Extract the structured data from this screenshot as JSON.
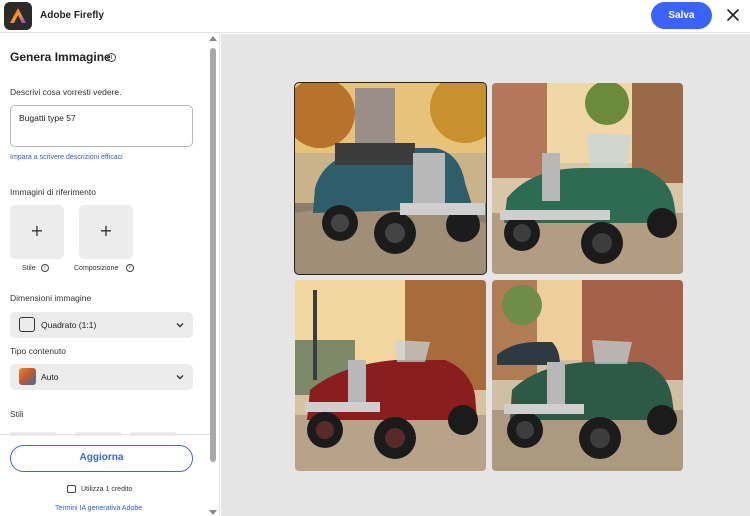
{
  "header": {
    "app_title": "Adobe Firefly",
    "save_label": "Salva",
    "logo_icon": "adobe-firefly-logo",
    "close_icon": "close-icon",
    "accent_color": "#3b63fb"
  },
  "sidebar": {
    "title": "Genera Immagine",
    "prompt_label": "Descrivi cosa vorresti vedere.",
    "prompt_value": "Bugatti type 57",
    "learn_link": "Impara a scrivere descrizioni efficaci",
    "reference_label": "Immagini di riferimento",
    "reference_items": [
      {
        "label": "Stile",
        "icon": "plus-icon"
      },
      {
        "label": "Composizione",
        "icon": "plus-icon"
      }
    ],
    "dimensions_label": "Dimensioni immagine",
    "dimensions_value": "Quadrato (1:1)",
    "content_type_label": "Tipo contenuto",
    "content_type_value": "Auto",
    "styles_label": "Stili",
    "update_label": "Aggiorna",
    "credits_text": "Utilizza 1 credito",
    "terms_link": "Termini IA generativa Adobe"
  },
  "gallery": {
    "images": [
      {
        "icon": "generated-image",
        "selected": true
      },
      {
        "icon": "generated-image",
        "selected": false
      },
      {
        "icon": "generated-image",
        "selected": false
      },
      {
        "icon": "generated-image",
        "selected": false
      }
    ]
  }
}
